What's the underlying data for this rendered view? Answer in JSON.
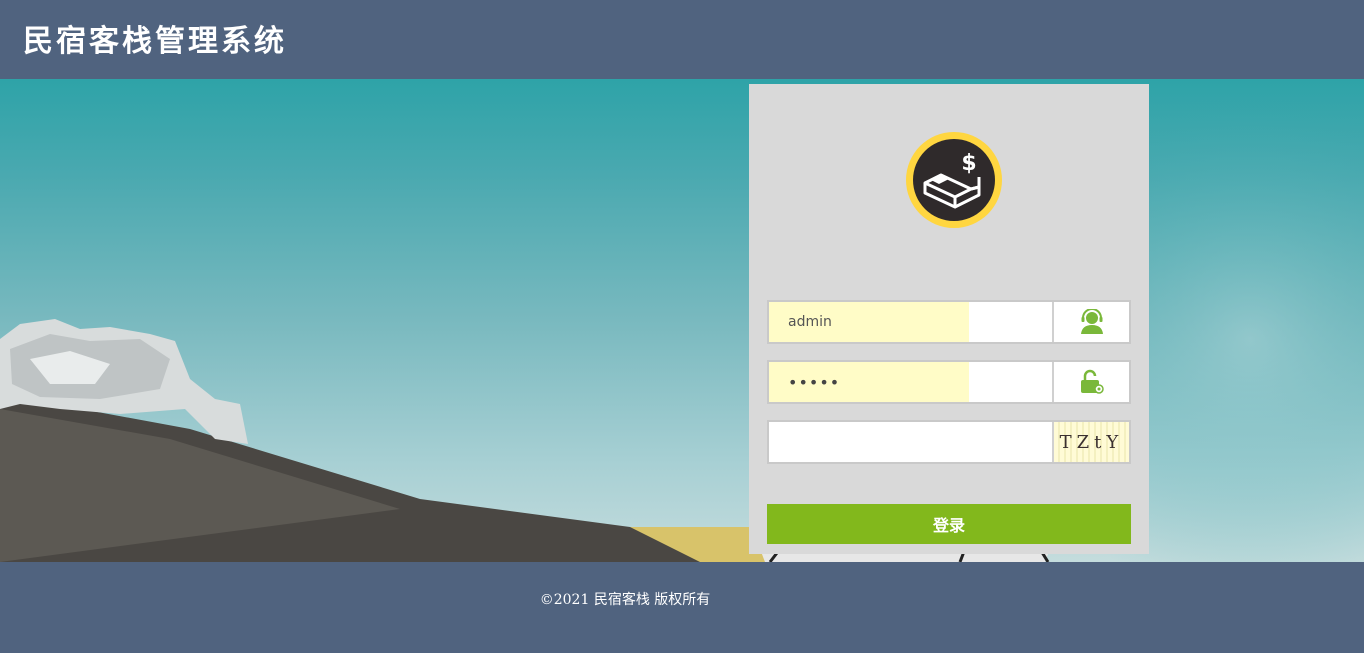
{
  "app": {
    "title": "民宿客栈管理系统"
  },
  "login": {
    "username_value": "admin",
    "password_value": "•••••",
    "captcha_value": "",
    "captcha_text": "TZtY",
    "submit_label": "登录",
    "user_icon": "user-headset-icon",
    "lock_icon": "unlock-icon"
  },
  "footer": {
    "copyright": "©2021  民宿客栈 版权所有"
  },
  "colors": {
    "header_bg": "#50637f",
    "panel_bg": "#d9d9d9",
    "button": "#82b81c",
    "icon_green": "#7ab83a",
    "autofill": "#fffcc7"
  }
}
